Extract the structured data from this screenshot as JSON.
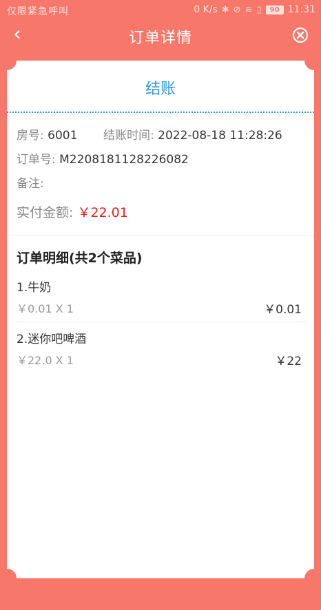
{
  "status_bar": {
    "carrier": "仅限紧急呼叫",
    "speed": "0 K/s",
    "battery": "90",
    "time": "11:31"
  },
  "header": {
    "title": "订单详情",
    "back_glyph": "‹"
  },
  "card": {
    "title": "结账",
    "room_label": "房号:",
    "room_value": "6001",
    "time_label": "结账时间:",
    "time_value": "2022-08-18 11:28:26",
    "order_label": "订单号:",
    "order_value": "M2208181128226082",
    "remark_label": "备注:",
    "paid_label": "实付金额:",
    "paid_value": "￥22.01"
  },
  "details": {
    "title": "订单明细(共2个菜品)",
    "items": [
      {
        "name": "1.牛奶",
        "unit": "￥0.01 X 1",
        "total": "￥0.01"
      },
      {
        "name": "2.迷你吧啤酒",
        "unit": "￥22.0 X 1",
        "total": "￥22"
      }
    ]
  },
  "colors": {
    "background": "#F7776A",
    "accent_blue": "#2F97E5",
    "amount_red": "#E8201C"
  }
}
